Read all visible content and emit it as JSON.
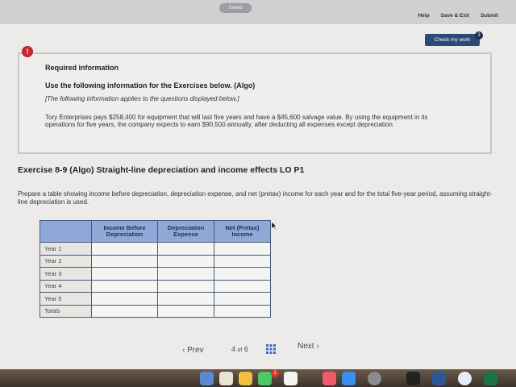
{
  "header": {
    "saved_label": "Saved",
    "help_label": "Help",
    "save_exit_label": "Save & Exit",
    "submit_label": "Submit",
    "check_work_label": "Check my work",
    "check_work_badge": "3"
  },
  "alert_icon_label": "!",
  "info": {
    "title": "Required information",
    "subtitle": "Use the following information for the Exercises below. (Algo)",
    "note": "[The following information applies to the questions displayed below.]",
    "body": "Tory Enterprises pays $258,400 for equipment that will last five years and have a $45,600 salvage value. By using the equipment in its operations for five years, the company expects to earn $90,500 annually, after deducting all expenses except depreciation."
  },
  "exercise": {
    "title": "Exercise 8-9 (Algo) Straight-line depreciation and income effects LO P1",
    "prompt": "Prepare a table showing income before depreciation, depreciation expense, and net (pretax) income for each year and for the total five-year period, assuming straight-line depreciation is used."
  },
  "table": {
    "headers": [
      "",
      "Income Before Depreciation",
      "Depreciation Expense",
      "Net (Pretax) Income"
    ],
    "rows": [
      "Year 1",
      "Year 2",
      "Year 3",
      "Year 4",
      "Year 5",
      "Totals"
    ]
  },
  "pager": {
    "prev_label": "Prev",
    "current": "4",
    "of_label": "of",
    "total": "6",
    "next_label": "Next"
  },
  "dock": {
    "badge": "1",
    "icons": [
      "finder-icon",
      "calendar-icon",
      "photos-icon",
      "messages-icon",
      "music-icon",
      "app-store-icon",
      "system-preferences-icon",
      "terminal-icon",
      "word-icon",
      "chrome-icon",
      "excel-icon"
    ]
  },
  "colors": {
    "table_header": "#8ea9d8",
    "check_button": "#2b4a7a",
    "alert": "#c2262e"
  }
}
